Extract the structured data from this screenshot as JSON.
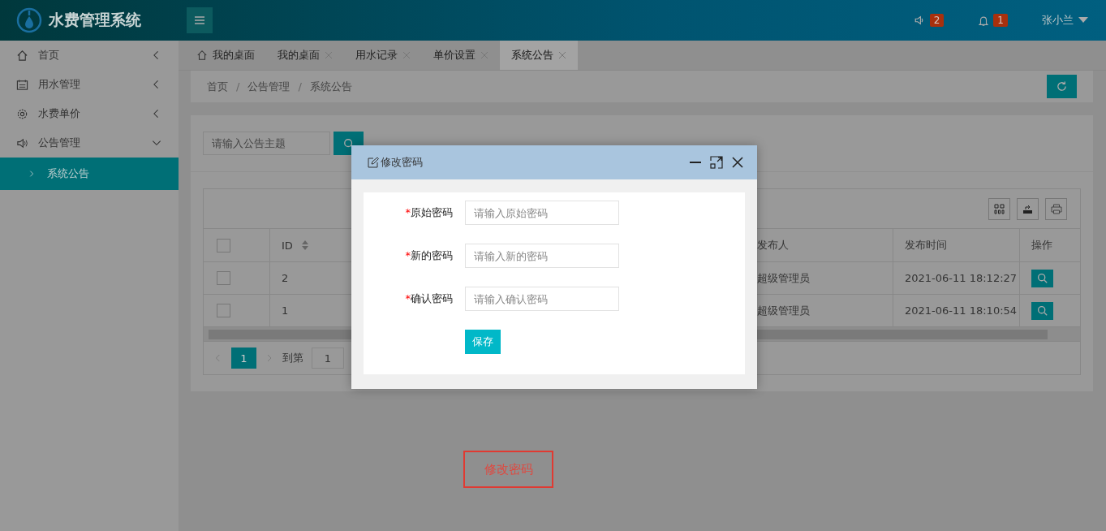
{
  "header": {
    "title": "水费管理系统",
    "notices": [
      {
        "kind": "speaker",
        "count": "2"
      },
      {
        "kind": "bell",
        "count": "1"
      }
    ],
    "user": "张小兰"
  },
  "sidebar": {
    "items": [
      {
        "label": "首页",
        "expanded": false
      },
      {
        "label": "用水管理",
        "expanded": false
      },
      {
        "label": "水费单价",
        "expanded": false
      },
      {
        "label": "公告管理",
        "expanded": true,
        "children": [
          {
            "label": "系统公告",
            "selected": true
          }
        ]
      }
    ]
  },
  "tabs": [
    {
      "label": "我的桌面",
      "kind": "home",
      "selected": false
    },
    {
      "label": "我的桌面",
      "kind": "closable",
      "selected": false
    },
    {
      "label": "用水记录",
      "kind": "closable",
      "selected": false
    },
    {
      "label": "单价设置",
      "kind": "closable",
      "selected": false
    },
    {
      "label": "系统公告",
      "kind": "closable",
      "selected": true
    }
  ],
  "breadcrumb": {
    "separator": "/",
    "items": [
      "首页",
      "公告管理",
      "系统公告"
    ]
  },
  "search": {
    "placeholder": "请输入公告主题"
  },
  "table": {
    "columns": [
      {
        "kind": "check",
        "checked": false
      },
      {
        "kind": "sort",
        "label": "ID"
      },
      {
        "kind": "hidden"
      },
      {
        "kind": "text",
        "label": "发布人"
      },
      {
        "kind": "text",
        "label": "发布时间"
      },
      {
        "kind": "text",
        "label": "操作"
      }
    ],
    "rows": [
      {
        "checked": false,
        "id": "2",
        "publisher": "超级管理员",
        "time": "2021-06-11 18:12:27"
      },
      {
        "checked": false,
        "id": "1",
        "publisher": "超级管理员",
        "time": "2021-06-11 18:10:54"
      }
    ]
  },
  "pager": {
    "pages": [
      {
        "label": "1",
        "selected": true
      }
    ],
    "goto_label": "到第",
    "goto_value": "1"
  },
  "caption": "修改密码",
  "dialog": {
    "title": "修改密码",
    "fields": [
      {
        "mark": "*",
        "label": "原始密码",
        "placeholder": "请输入原始密码"
      },
      {
        "mark": "*",
        "label": "新的密码",
        "placeholder": "请输入新的密码"
      },
      {
        "mark": "*",
        "label": "确认密码",
        "placeholder": "请输入确认密码"
      }
    ],
    "button": "保存"
  }
}
